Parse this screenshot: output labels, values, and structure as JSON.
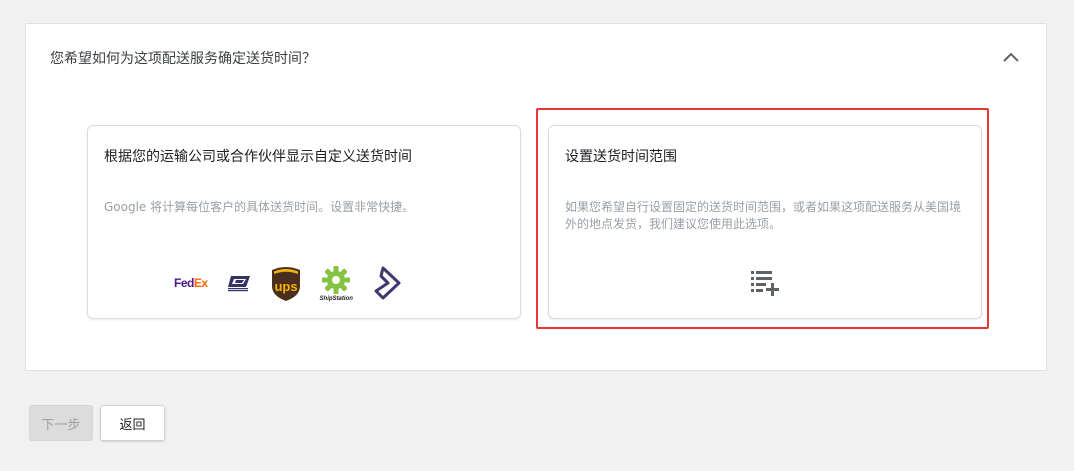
{
  "question": "您希望如何为这项配送服务确定送货时间？",
  "options": [
    {
      "title": "根据您的运输公司或合作伙伴显示自定义送货时间",
      "description": "Google 将计算每位客户的具体送货时间。设置非常快捷。",
      "logos": {
        "fedex_fe": "Fed",
        "fedex_ex": "Ex",
        "ups": "ups",
        "shipstation": "ShipStation"
      }
    },
    {
      "title": "设置送货时间范围",
      "description": "如果您希望自行设置固定的送货时间范围，或者如果这项配送服务从美国境外的地点发货，我们建议您使用此选项。",
      "icon": "playlist-add-icon"
    }
  ],
  "buttons": {
    "next": "下一步",
    "back": "返回"
  },
  "colors": {
    "highlight": "#e53935",
    "fedex_purple": "#4d148c",
    "fedex_orange": "#ff6600",
    "ups_brown": "#4a2f1e",
    "ups_gold": "#f4b400",
    "usps_blue": "#333366",
    "shipstation_green": "#84c341"
  }
}
